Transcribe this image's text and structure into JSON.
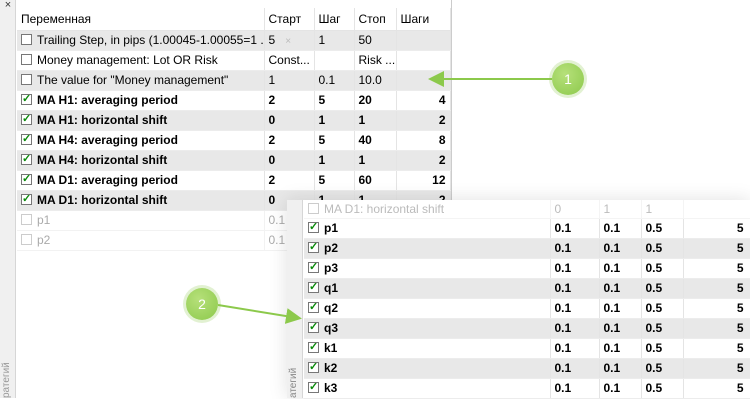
{
  "colors": {
    "accent_green": "#8cc94b",
    "row_gray": "#e8e8e8",
    "check_green": "#0a8a0a"
  },
  "panel1": {
    "close_glyph": "×",
    "side_label": "ратегий",
    "columns": [
      "Переменная",
      "Старт",
      "Шаг",
      "Стоп",
      "Шаги"
    ],
    "rows": [
      {
        "name": "Trailing Step, in pips (1.00045-1.00055=1 ...",
        "checked": false,
        "bold": false,
        "gray": true,
        "start": "5",
        "step": "1",
        "stop": "50",
        "steps": ""
      },
      {
        "name": "Money management: Lot OR Risk",
        "checked": false,
        "bold": false,
        "gray": false,
        "start": "Const...",
        "step": "",
        "stop": "Risk ...",
        "steps": ""
      },
      {
        "name": "The value for \"Money management\"",
        "checked": false,
        "bold": false,
        "gray": true,
        "start": "1",
        "step": "0.1",
        "stop": "10.0",
        "steps": ""
      },
      {
        "name": "MA H1: averaging period",
        "checked": true,
        "bold": true,
        "gray": false,
        "start": "2",
        "step": "5",
        "stop": "20",
        "steps": "4"
      },
      {
        "name": "MA H1: horizontal shift",
        "checked": true,
        "bold": true,
        "gray": true,
        "start": "0",
        "step": "1",
        "stop": "1",
        "steps": "2"
      },
      {
        "name": "MA H4: averaging period",
        "checked": true,
        "bold": true,
        "gray": false,
        "start": "2",
        "step": "5",
        "stop": "40",
        "steps": "8"
      },
      {
        "name": "MA H4: horizontal shift",
        "checked": true,
        "bold": true,
        "gray": true,
        "start": "0",
        "step": "1",
        "stop": "1",
        "steps": "2"
      },
      {
        "name": "MA D1: averaging period",
        "checked": true,
        "bold": true,
        "gray": false,
        "start": "2",
        "step": "5",
        "stop": "60",
        "steps": "12"
      },
      {
        "name": "MA D1: horizontal shift",
        "checked": true,
        "bold": true,
        "gray": true,
        "start": "0",
        "step": "1",
        "stop": "1",
        "steps": "2"
      }
    ],
    "faded_rows": [
      {
        "name": "p1",
        "start": "0.1"
      },
      {
        "name": "p2",
        "start": "0.1"
      }
    ]
  },
  "panel2": {
    "side_label": "атегий",
    "faded_row": {
      "name": "MA D1: horizontal shift",
      "start": "0",
      "step": "1",
      "stop": "1"
    },
    "rows": [
      {
        "name": "p1",
        "start": "0.1",
        "step": "0.1",
        "stop": "0.5",
        "steps": "5",
        "gray": false
      },
      {
        "name": "p2",
        "start": "0.1",
        "step": "0.1",
        "stop": "0.5",
        "steps": "5",
        "gray": true
      },
      {
        "name": "p3",
        "start": "0.1",
        "step": "0.1",
        "stop": "0.5",
        "steps": "5",
        "gray": false
      },
      {
        "name": "q1",
        "start": "0.1",
        "step": "0.1",
        "stop": "0.5",
        "steps": "5",
        "gray": true
      },
      {
        "name": "q2",
        "start": "0.1",
        "step": "0.1",
        "stop": "0.5",
        "steps": "5",
        "gray": false
      },
      {
        "name": "q3",
        "start": "0.1",
        "step": "0.1",
        "stop": "0.5",
        "steps": "5",
        "gray": true
      },
      {
        "name": "k1",
        "start": "0.1",
        "step": "0.1",
        "stop": "0.5",
        "steps": "5",
        "gray": false
      },
      {
        "name": "k2",
        "start": "0.1",
        "step": "0.1",
        "stop": "0.5",
        "steps": "5",
        "gray": true
      },
      {
        "name": "k3",
        "start": "0.1",
        "step": "0.1",
        "stop": "0.5",
        "steps": "5",
        "gray": false
      }
    ]
  },
  "callouts": [
    "1",
    "2"
  ]
}
